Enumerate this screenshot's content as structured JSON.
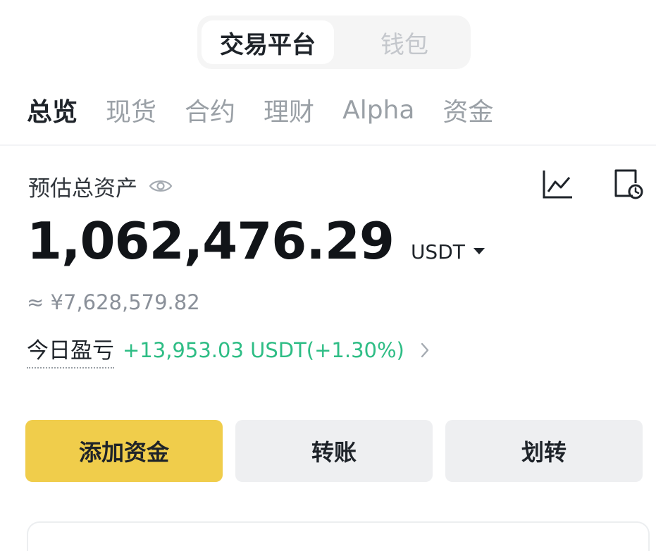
{
  "top_toggle": {
    "active": "交易平台",
    "inactive": "钱包"
  },
  "tabs": [
    {
      "label": "总览",
      "active": true
    },
    {
      "label": "现货",
      "active": false
    },
    {
      "label": "合约",
      "active": false
    },
    {
      "label": "理财",
      "active": false
    },
    {
      "label": "Alpha",
      "active": false
    },
    {
      "label": "资金",
      "active": false
    }
  ],
  "overview": {
    "estimated_label": "预估总资产",
    "balance": "1,062,476.29",
    "currency": "USDT",
    "fiat_value": "≈ ¥7,628,579.82",
    "pnl_label": "今日盈亏",
    "pnl_value": "+13,953.03 USDT(+1.30%)"
  },
  "icons": {
    "visibility": "eye-icon",
    "chart": "line-chart-icon",
    "history": "history-clock-icon",
    "pnl_chevron": "chevron-right-icon",
    "currency_dropdown": "caret-down-icon"
  },
  "actions": {
    "add_funds": "添加资金",
    "transfer": "转账",
    "internal_transfer": "划转"
  },
  "colors": {
    "accent": "#f0cd4b",
    "positive": "#2ebd85",
    "button_gray": "#eeeff1",
    "text_primary": "#1e2329",
    "text_muted": "#9aa0a6"
  }
}
